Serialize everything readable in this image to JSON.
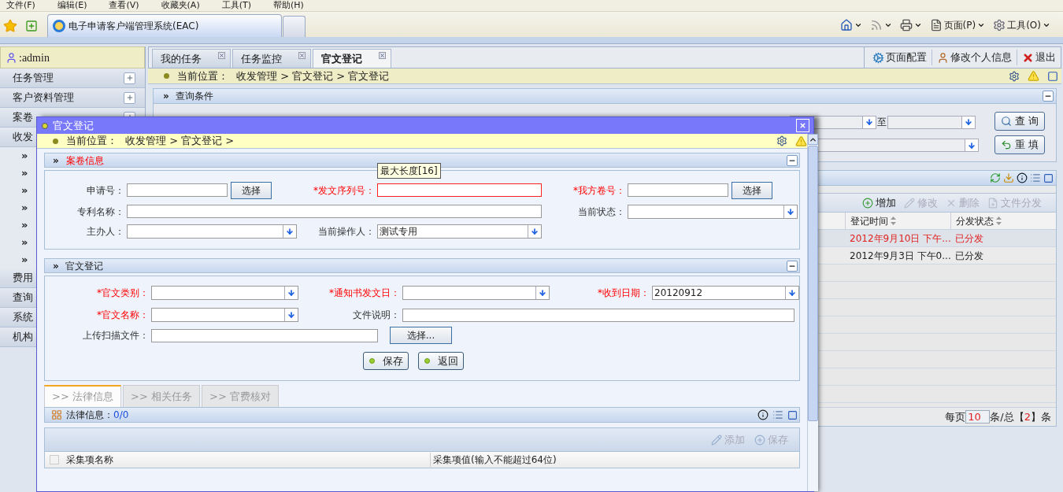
{
  "browser": {
    "menu": [
      "文件(F)",
      "编辑(E)",
      "查看(V)",
      "收藏夹(A)",
      "工具(T)",
      "帮助(H)"
    ],
    "tab": "电子申请客户端管理系统(EAC)",
    "commands": [
      {
        "kind": "home"
      },
      {
        "kind": "feed"
      },
      {
        "kind": "print"
      },
      {
        "kind": "page",
        "label": "页面(P)"
      },
      {
        "kind": "tools",
        "label": "工具(O)"
      }
    ]
  },
  "user": ":admin",
  "sidebar": {
    "items": [
      {
        "label": "任务管理",
        "expanded": false
      },
      {
        "label": "客户资料管理",
        "expanded": false
      },
      {
        "label": "案卷",
        "expanded": false
      },
      {
        "label": "收发",
        "children": [
          "»",
          "»",
          "»",
          "»",
          "»",
          "»",
          "»"
        ]
      },
      {
        "label": "费用"
      },
      {
        "label": "查询"
      },
      {
        "label": "系统"
      },
      {
        "label": "机构"
      }
    ]
  },
  "tabs": [
    {
      "label": "我的任务",
      "selected": false
    },
    {
      "label": "任务监控",
      "selected": false
    },
    {
      "label": "官文登记",
      "selected": true
    }
  ],
  "top_actions": [
    {
      "kind": "config",
      "label": "页面配置"
    },
    {
      "kind": "profile",
      "label": "修改个人信息"
    },
    {
      "kind": "logout",
      "label": "退出"
    }
  ],
  "breadcrumb": {
    "label": "当前位置：",
    "path": "收发管理 > 官文登记 > 官文登记"
  },
  "query": {
    "marker": "»",
    "title": "查询条件",
    "to_label": "至",
    "buttons": [
      {
        "kind": "search",
        "label": "查 询"
      },
      {
        "kind": "reset",
        "label": "重 填"
      }
    ]
  },
  "grid": {
    "toolbar": [
      {
        "kind": "add",
        "label": "增加",
        "disabled": false
      },
      {
        "kind": "edit",
        "label": "修改",
        "disabled": true
      },
      {
        "kind": "delete",
        "label": "删除",
        "disabled": true
      },
      {
        "kind": "distribute",
        "label": "文件分发",
        "disabled": true
      }
    ],
    "columns": [
      "登记时间",
      "分发状态"
    ],
    "rows": [
      {
        "cells": [
          "2012年9月10日 下午...",
          "已分发"
        ],
        "selected": true
      },
      {
        "cells": [
          "2012年9月3日 下午0...",
          "已分发"
        ],
        "selected": false
      }
    ],
    "pager": {
      "per_page": "每页",
      "size": "10",
      "of_total": "条/总",
      "open": "【",
      "total": "2",
      "close": "】",
      "unit": "条"
    }
  },
  "dialog": {
    "title": "官文登记",
    "breadcrumb": {
      "label": "当前位置：",
      "path": "收发管理 > 官文登记 >"
    },
    "case_section": {
      "marker": "»",
      "title": "案卷信息",
      "rows": [
        [
          {
            "label": "申请号：",
            "required": false,
            "kind": "pick",
            "button": "选择"
          },
          {
            "label": "*发文序列号：",
            "required": true,
            "kind": "text",
            "invalid": true,
            "tooltip": "最大长度[16]"
          },
          {
            "label": "*我方卷号：",
            "required": true,
            "kind": "pick",
            "button": "选择"
          }
        ],
        [
          {
            "label": "专利名称：",
            "required": false,
            "kind": "wide",
            "colspan": 2
          },
          {
            "label": "当前状态：",
            "required": false,
            "kind": "select"
          }
        ],
        [
          {
            "label": "主办人：",
            "required": false,
            "kind": "select"
          },
          {
            "label": "当前操作人：",
            "required": false,
            "kind": "select",
            "value": "测试专用"
          }
        ]
      ]
    },
    "reg_section": {
      "marker": "»",
      "title": "官文登记",
      "rows": [
        [
          {
            "label": "*官文类别：",
            "required": true,
            "kind": "select"
          },
          {
            "label": "*通知书发文日：",
            "required": true,
            "kind": "select"
          },
          {
            "label": "*收到日期：",
            "required": true,
            "kind": "select",
            "value": "20120912"
          }
        ],
        [
          {
            "label": "*官文名称：",
            "required": true,
            "kind": "select"
          },
          {
            "label": "文件说明：",
            "required": false,
            "kind": "wide",
            "colspan": 2
          }
        ],
        [
          {
            "label": "上传扫描文件：",
            "required": false,
            "kind": "upload",
            "button": "选择..."
          }
        ]
      ],
      "buttons": [
        "保存",
        "返回"
      ]
    },
    "tabs": [
      {
        "label": ">> 法律信息",
        "selected": true
      },
      {
        "label": ">> 相关任务",
        "selected": false
      },
      {
        "label": ">> 官费核对",
        "selected": false
      }
    ],
    "panel": {
      "title": "法律信息：",
      "count": "0/0",
      "toolbar": [
        {
          "kind": "append",
          "label": "添加",
          "disabled": true
        },
        {
          "kind": "save",
          "label": "保存",
          "disabled": true
        }
      ],
      "select_all": {
        "checked": false
      },
      "columns": [
        "采集项名称",
        "采集项值(输入不能超过64位)"
      ]
    }
  }
}
